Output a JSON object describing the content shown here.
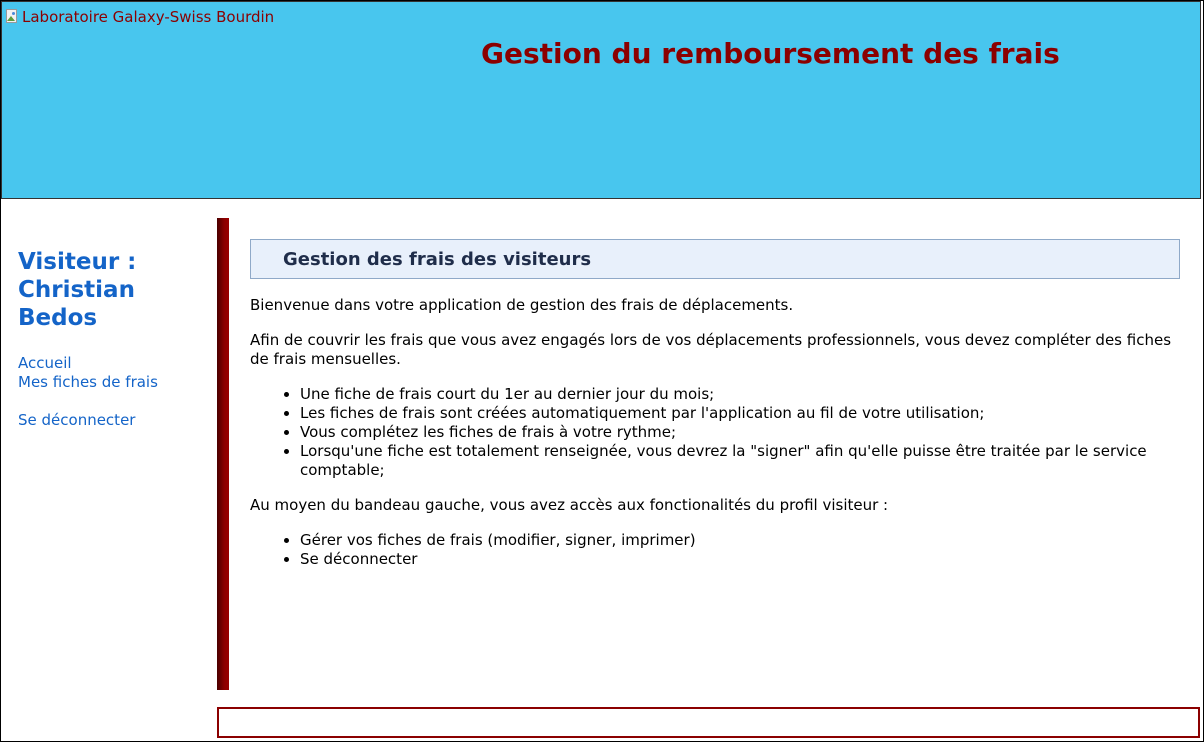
{
  "header": {
    "logo_alt": "Laboratoire Galaxy-Swiss Bourdin",
    "title": "Gestion du remboursement des frais",
    "background_color": "#48c6ee",
    "title_color": "#8b0000"
  },
  "sidebar": {
    "visitor_label": "Visiteur :",
    "visitor_name": "Christian Bedos",
    "nav": {
      "home": "Accueil",
      "my_expense_sheets": "Mes fiches de frais",
      "logout": "Se déconnecter"
    },
    "link_color": "#1464c8"
  },
  "content": {
    "title": "Gestion des frais des visiteurs",
    "intro": "Bienvenue dans votre application de gestion des frais de déplacements.",
    "paragraph": "Afin de couvrir les frais que vous avez engagés lors de vos déplacements professionnels, vous devez compléter des fiches de frais mensuelles.",
    "rules": [
      "Une fiche de frais court du 1er au dernier jour du mois;",
      "Les fiches de frais sont créées automatiquement par l'application au fil de votre utilisation;",
      "Vous complétez les fiches de frais à votre rythme;",
      "Lorsqu'une fiche est totalement renseignée, vous devrez la \"signer\" afin qu'elle puisse être traitée par le service comptable;"
    ],
    "features_intro": "Au moyen du bandeau gauche, vous avez accès aux fonctionalités du profil visiteur :",
    "features": [
      "Gérer vos fiches de frais (modifier, signer, imprimer)",
      "Se déconnecter"
    ]
  },
  "accent_color": "#8b0000"
}
